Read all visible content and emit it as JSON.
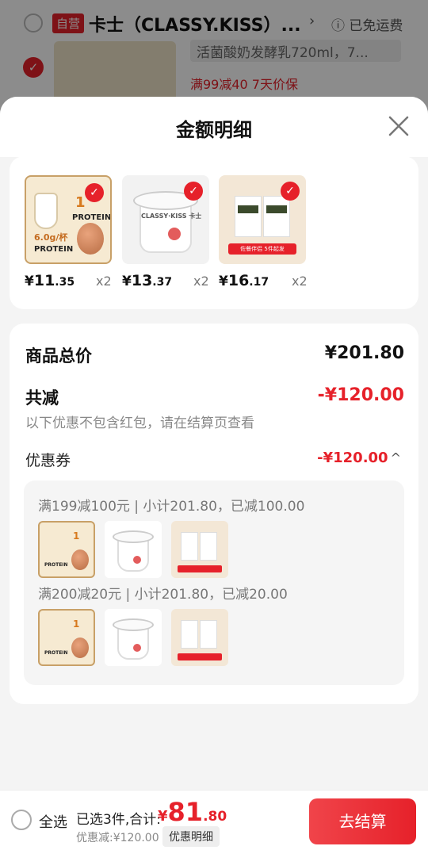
{
  "background_cart": {
    "store_tag": "自营",
    "store_title": "卡士（CLASSY.KISS）...",
    "arrow": "›",
    "shipping": "ⓘ 已免运费",
    "spec": "活菌酸奶发酵乳720ml，7...",
    "promo": "满99减40  7天价保"
  },
  "sheet": {
    "title": "金额明细",
    "close_icon": "close-icon"
  },
  "products": [
    {
      "name": "protein",
      "currency": "¥",
      "int": "11",
      "dec": ".35",
      "qty": "x2",
      "lbl_big": "PROTEIN",
      "lbl_num": "6.0g/杯",
      "lbl_one": "1"
    },
    {
      "name": "yogurt",
      "currency": "¥",
      "int": "13",
      "dec": ".37",
      "qty": "x2",
      "brand": "CLASSY·KISS 卡士"
    },
    {
      "name": "box",
      "currency": "¥",
      "int": "16",
      "dec": ".17",
      "qty": "x2",
      "banner": "佐餐伴侣 5件起发"
    }
  ],
  "summary": {
    "total_label": "商品总价",
    "total_value": "¥201.80",
    "reduce_label": "共减",
    "reduce_value": "-¥120.00",
    "note": "以下优惠不包含红包，请在结算页查看",
    "coupon_label": "优惠券",
    "coupon_value": "-¥120.00",
    "coupon_chevron": "^"
  },
  "coupons": [
    {
      "line": "满199减100元 | 小计201.80，已减100.00"
    },
    {
      "line": "满200减20元 | 小计201.80，已减20.00"
    }
  ],
  "bottom": {
    "all_label": "全选",
    "selected_label": "已选3件,合计:",
    "currency": "¥",
    "total_int": "81",
    "total_dec": ".80",
    "discount_label": "优惠减:¥120.00",
    "detail_label": "优惠明细",
    "checkout_label": "去结算"
  },
  "colors": {
    "accent": "#e6212a",
    "background": "#f4f4f4"
  }
}
